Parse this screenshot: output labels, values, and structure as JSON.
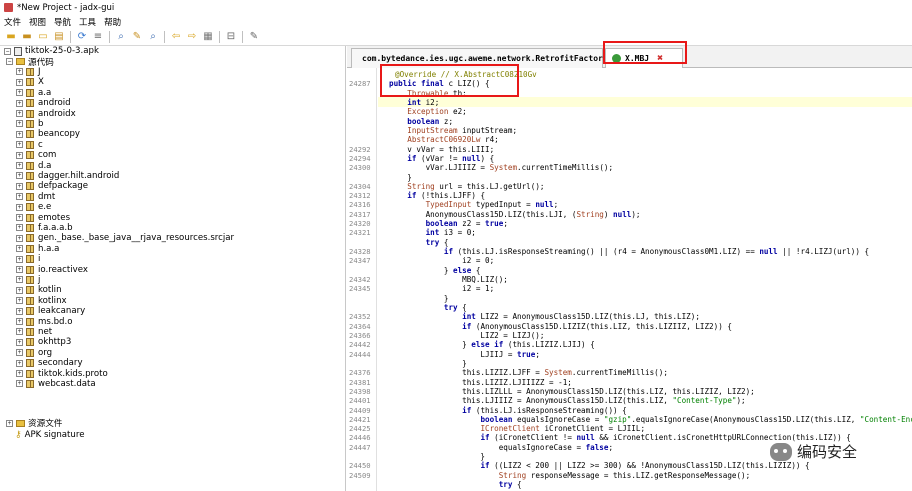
{
  "window": {
    "title": "*New Project - jadx-gui"
  },
  "menu": [
    "文件",
    "视图",
    "导航",
    "工具",
    "帮助"
  ],
  "toolbar": {
    "icons": [
      "open-icon",
      "save-icon",
      "save-all-icon",
      "export-icon",
      "sync-icon",
      "tree-icon",
      "search-icon",
      "search-class-icon",
      "find-icon",
      "back-icon",
      "forward-icon",
      "deobf-icon",
      "log-icon",
      "settings-icon"
    ]
  },
  "tree": {
    "root": "tiktok-25-0-3.apk",
    "source": "源代码",
    "packages": [
      "J",
      "X",
      "a.a",
      "android",
      "androidx",
      "b",
      "beancopy",
      "c",
      "com",
      "d.a",
      "dagger.hilt.android",
      "defpackage",
      "dmt",
      "e.e",
      "emotes",
      "f.a.a.a.b",
      "gen._base._base_java__rjava_resources.srcjar",
      "h.a.a",
      "i",
      "io.reactivex",
      "j",
      "kotlin",
      "kotlinx",
      "leakcanary",
      "ms.bd.o",
      "net",
      "okhttp3",
      "org",
      "secondary",
      "tiktok.kids.proto",
      "webcast.data"
    ],
    "resources": "资源文件",
    "signature": "APK signature"
  },
  "tabs": [
    {
      "label": "com.bytedance.ies.ugc.aweme.network.RetrofitFactory"
    },
    {
      "label": "X.MBJ"
    }
  ],
  "code": {
    "lines": [
      {
        "n": "",
        "t": "@Override // X.AbstractC08210Gv"
      },
      {
        "n": "24287",
        "t": "public final c LIZ() {"
      },
      {
        "n": "",
        "t": "    Throwable th;"
      },
      {
        "n": "",
        "t": "    int i2;"
      },
      {
        "n": "",
        "t": "    Exception e2;"
      },
      {
        "n": "",
        "t": "    boolean z;"
      },
      {
        "n": "",
        "t": "    InputStream inputStream;"
      },
      {
        "n": "",
        "t": "    AbstractC06920Lw r4;"
      },
      {
        "n": "24292",
        "t": "    v vVar = this.LIII;"
      },
      {
        "n": "24294",
        "t": "    if (vVar != null) {"
      },
      {
        "n": "24300",
        "t": "        vVar.LJIIIZ = System.currentTimeMillis();"
      },
      {
        "n": "",
        "t": "    }"
      },
      {
        "n": "24304",
        "t": "    String url = this.LJ.getUrl();"
      },
      {
        "n": "24312",
        "t": "    if (!this.LJFF) {"
      },
      {
        "n": "24316",
        "t": "        TypedInput typedInput = null;"
      },
      {
        "n": "24317",
        "t": "        AnonymousClass15D.LIZ(this.LJI, (String) null);"
      },
      {
        "n": "24320",
        "t": "        boolean z2 = true;"
      },
      {
        "n": "24321",
        "t": "        int i3 = 0;"
      },
      {
        "n": "",
        "t": "        try {"
      },
      {
        "n": "24328",
        "t": "            if (this.LJ.isResponseStreaming() || (r4 = AnonymousClass0M1.LIZ) == null || !r4.LIZJ(url)) {"
      },
      {
        "n": "24347",
        "t": "                i2 = 0;"
      },
      {
        "n": "",
        "t": "            } else {"
      },
      {
        "n": "24342",
        "t": "                MBQ.LIZ();"
      },
      {
        "n": "24345",
        "t": "                i2 = 1;"
      },
      {
        "n": "",
        "t": "            }"
      },
      {
        "n": "",
        "t": "            try {"
      },
      {
        "n": "24352",
        "t": "                int LIZ2 = AnonymousClass15D.LIZ(this.LJ, this.LIZ);"
      },
      {
        "n": "24364",
        "t": "                if (AnonymousClass15D.LIZIZ(this.LIZ, this.LIZIIZ, LIZ2)) {"
      },
      {
        "n": "24366",
        "t": "                    LIZ2 = LIZJ();"
      },
      {
        "n": "24442",
        "t": "                } else if (this.LIZIZ.LJIJ) {"
      },
      {
        "n": "24444",
        "t": "                    LJIIJ = true;"
      },
      {
        "n": "",
        "t": "                }"
      },
      {
        "n": "24376",
        "t": "                this.LIZIZ.LJFF = System.currentTimeMillis();"
      },
      {
        "n": "24381",
        "t": "                this.LIZIZ.LJIIIZZ = -1;"
      },
      {
        "n": "24398",
        "t": "                this.LIZLLL = AnonymousClass15D.LIZ(this.LIZ, this.LIZIZ, LIZ2);"
      },
      {
        "n": "24401",
        "t": "                this.LJIIIZ = AnonymousClass15D.LIZ(this.LIZ, \"Content-Type\");"
      },
      {
        "n": "24409",
        "t": "                if (this.LJ.isResponseStreaming()) {"
      },
      {
        "n": "24421",
        "t": "                    boolean equalsIgnoreCase = \"gzip\".equalsIgnoreCase(AnonymousClass15D.LIZ(this.LIZ, \"Content-Encoding\"));"
      },
      {
        "n": "24425",
        "t": "                    ICronetClient iCronetClient = LJIIL;"
      },
      {
        "n": "24446",
        "t": "                    if (iCronetClient != null && iCronetClient.isCronetHttpURLConnection(this.LIZ)) {"
      },
      {
        "n": "24447",
        "t": "                        equalsIgnoreCase = false;"
      },
      {
        "n": "",
        "t": "                    }"
      },
      {
        "n": "24450",
        "t": "                    if ((LIZ2 < 200 || LIZ2 >= 300) && !AnonymousClass15D.LIZ(this.LIZIZ)) {"
      },
      {
        "n": "24509",
        "t": "                        String responseMessage = this.LIZ.getResponseMessage();"
      },
      {
        "n": "",
        "t": "                        try {"
      }
    ]
  },
  "watermark": "编码安全"
}
